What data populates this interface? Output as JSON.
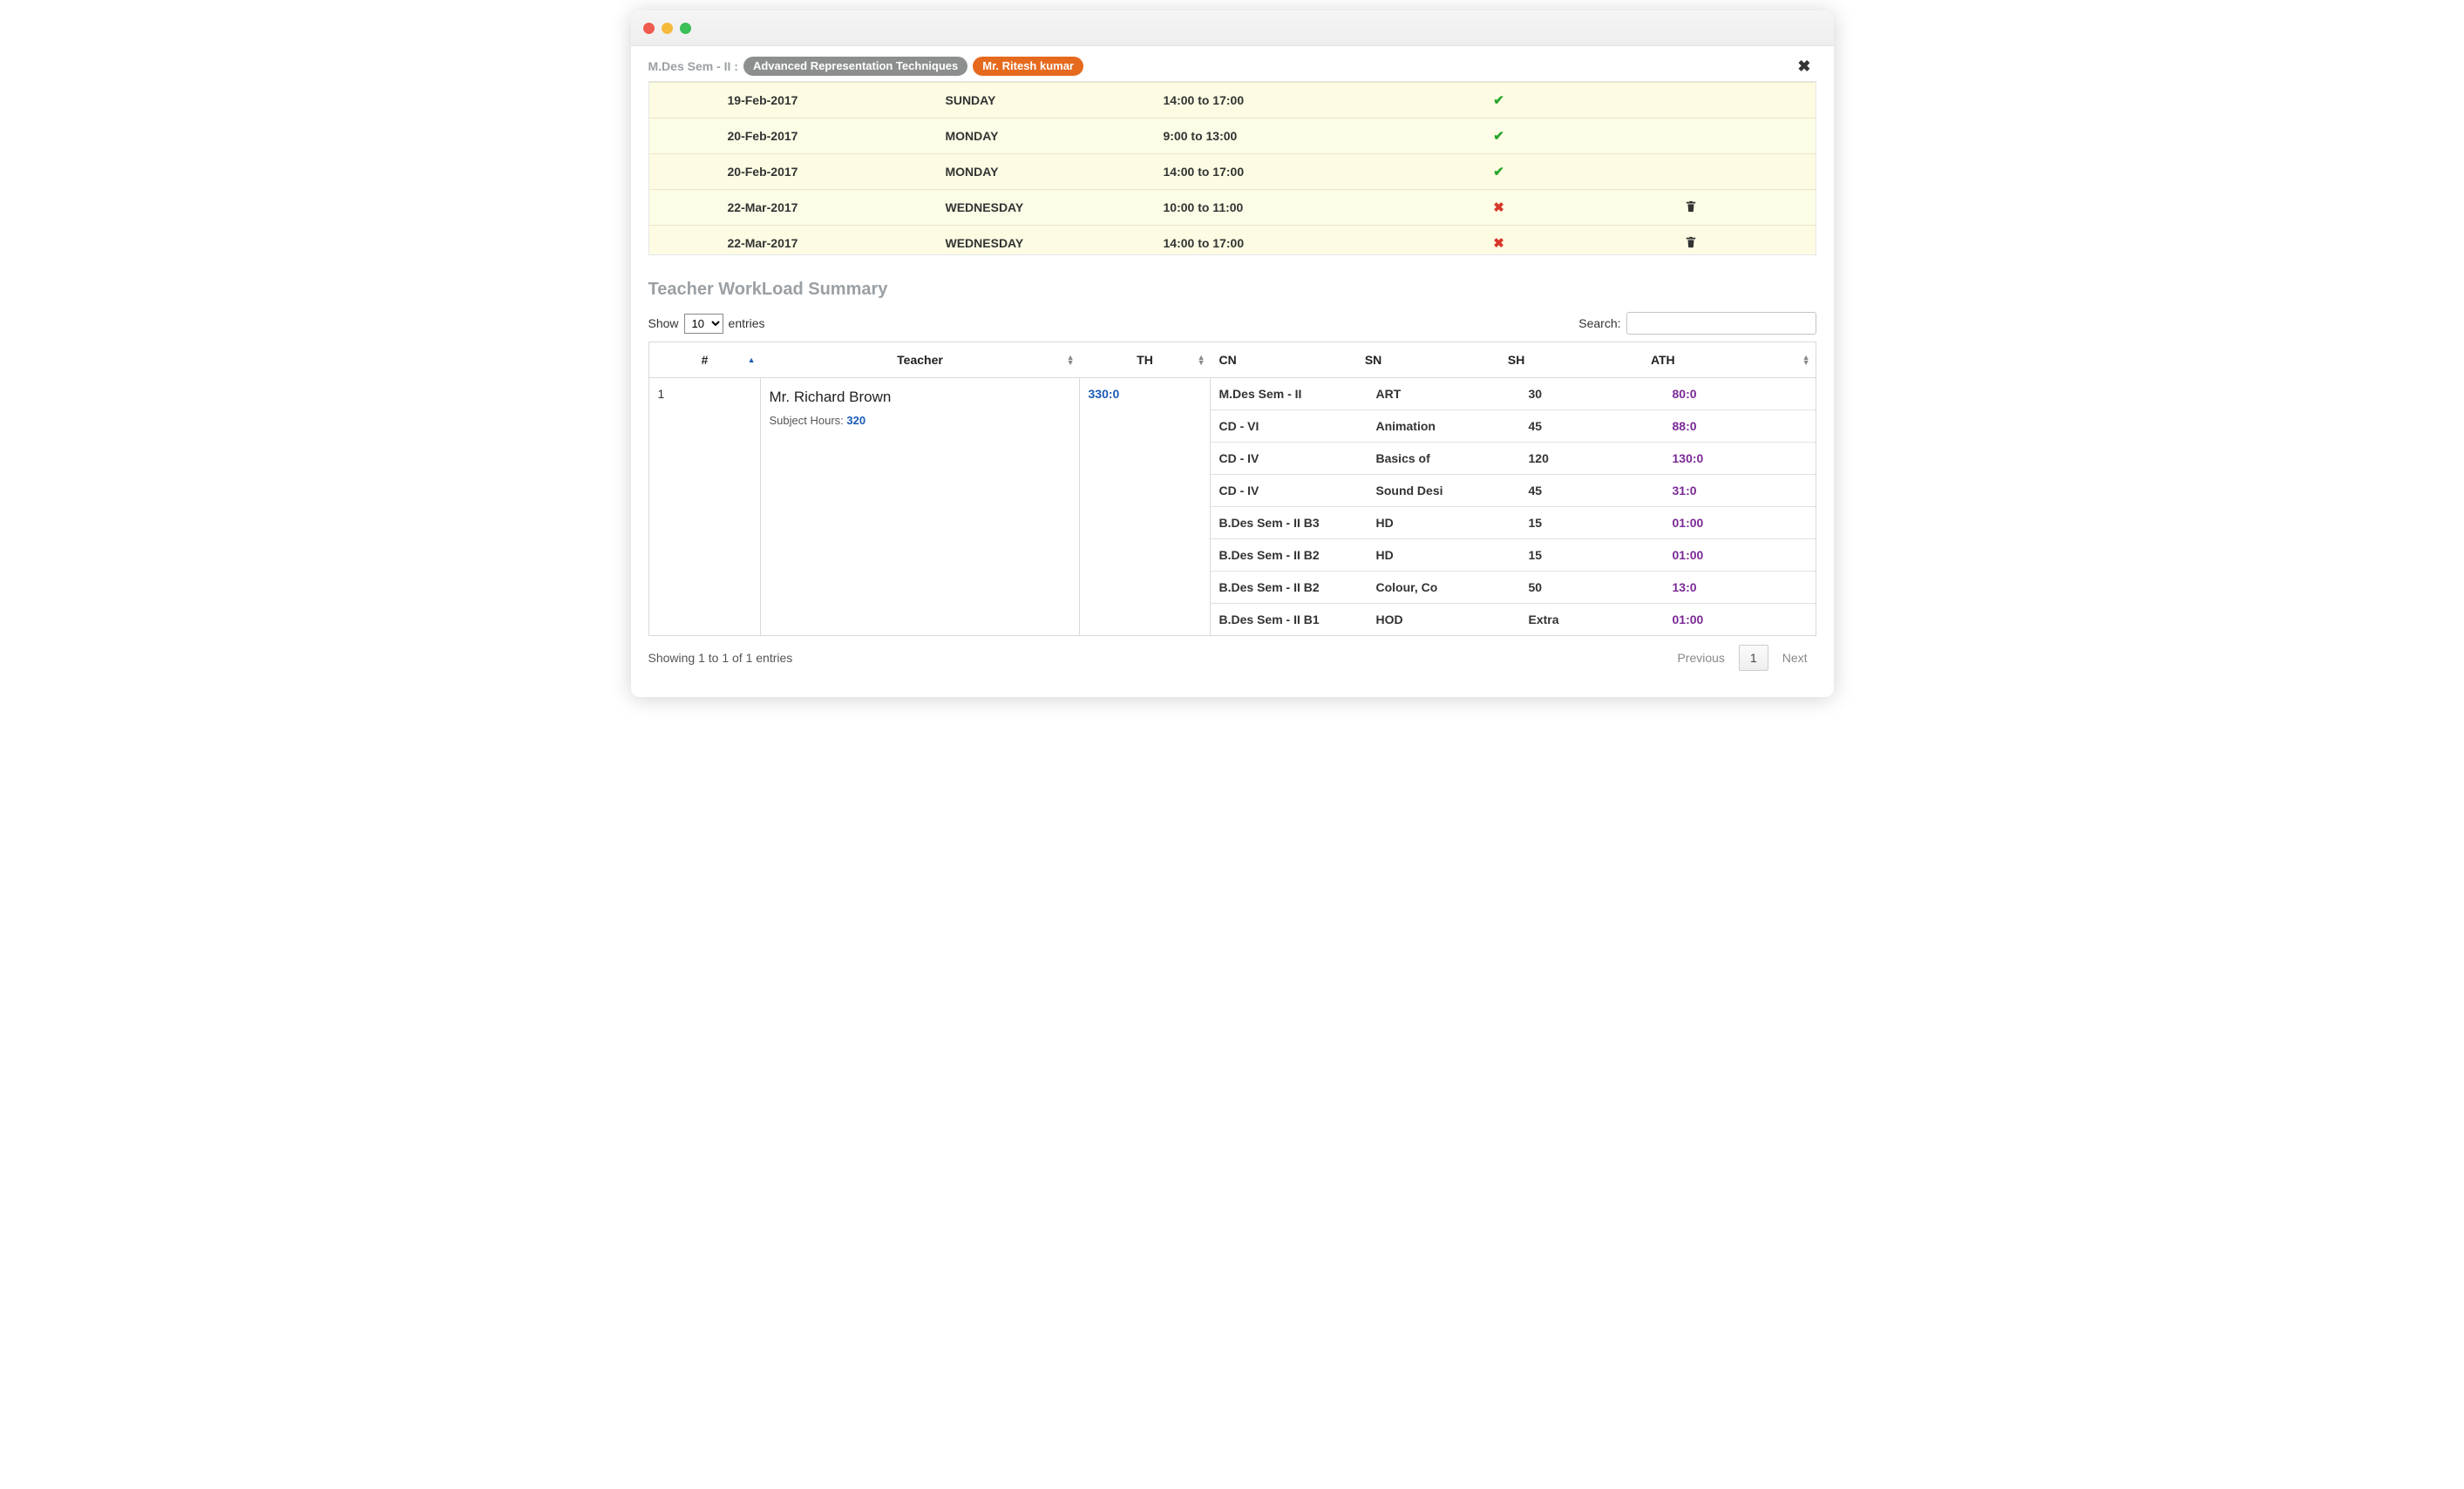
{
  "crumb": {
    "program": "M.Des Sem - II :",
    "subject": "Advanced Representation Techniques",
    "teacher": "Mr. Ritesh kumar"
  },
  "schedule": [
    {
      "date": "19-Feb-2017",
      "day": "SUNDAY",
      "time": "14:00 to 17:00",
      "ok": true,
      "del": false
    },
    {
      "date": "20-Feb-2017",
      "day": "MONDAY",
      "time": "9:00 to 13:00",
      "ok": true,
      "del": false
    },
    {
      "date": "20-Feb-2017",
      "day": "MONDAY",
      "time": "14:00 to 17:00",
      "ok": true,
      "del": false
    },
    {
      "date": "22-Mar-2017",
      "day": "WEDNESDAY",
      "time": "10:00 to 11:00",
      "ok": false,
      "del": true
    },
    {
      "date": "22-Mar-2017",
      "day": "WEDNESDAY",
      "time": "14:00 to 17:00",
      "ok": false,
      "del": true
    }
  ],
  "summary_title": "Teacher WorkLoad Summary",
  "dt": {
    "show_label_pre": "Show",
    "show_value": "10",
    "show_label_post": "entries",
    "search_label": "Search:",
    "info": "Showing 1 to 1 of 1 entries",
    "prev": "Previous",
    "page": "1",
    "next": "Next"
  },
  "cols": {
    "hash": "#",
    "teacher": "Teacher",
    "th": "TH",
    "cn": "CN",
    "sn": "SN",
    "sh": "SH",
    "ath": "ATH"
  },
  "row": {
    "idx": "1",
    "prefix": "Mr.",
    "name": "Richard Brown",
    "sub_label": "Subject Hours: ",
    "sub_val": "320",
    "th": "330:0",
    "details": [
      {
        "cn": "M.Des Sem - II",
        "sn": "ART",
        "sh": "30",
        "ath": "80:0"
      },
      {
        "cn": "CD - VI",
        "sn": "Animation",
        "sh": "45",
        "ath": "88:0"
      },
      {
        "cn": "CD - IV",
        "sn": "Basics of",
        "sh": "120",
        "ath": "130:0"
      },
      {
        "cn": "CD - IV",
        "sn": "Sound Desi",
        "sh": "45",
        "ath": "31:0"
      },
      {
        "cn": "B.Des Sem - II B3",
        "sn": "HD",
        "sh": "15",
        "ath": "01:00"
      },
      {
        "cn": "B.Des Sem - II B2",
        "sn": "HD",
        "sh": "15",
        "ath": "01:00"
      },
      {
        "cn": "B.Des Sem - II B2",
        "sn": "Colour, Co",
        "sh": "50",
        "ath": "13:0"
      },
      {
        "cn": "B.Des Sem - II B1",
        "sn": "HOD",
        "sh": "Extra",
        "ath": "01:00"
      }
    ]
  }
}
